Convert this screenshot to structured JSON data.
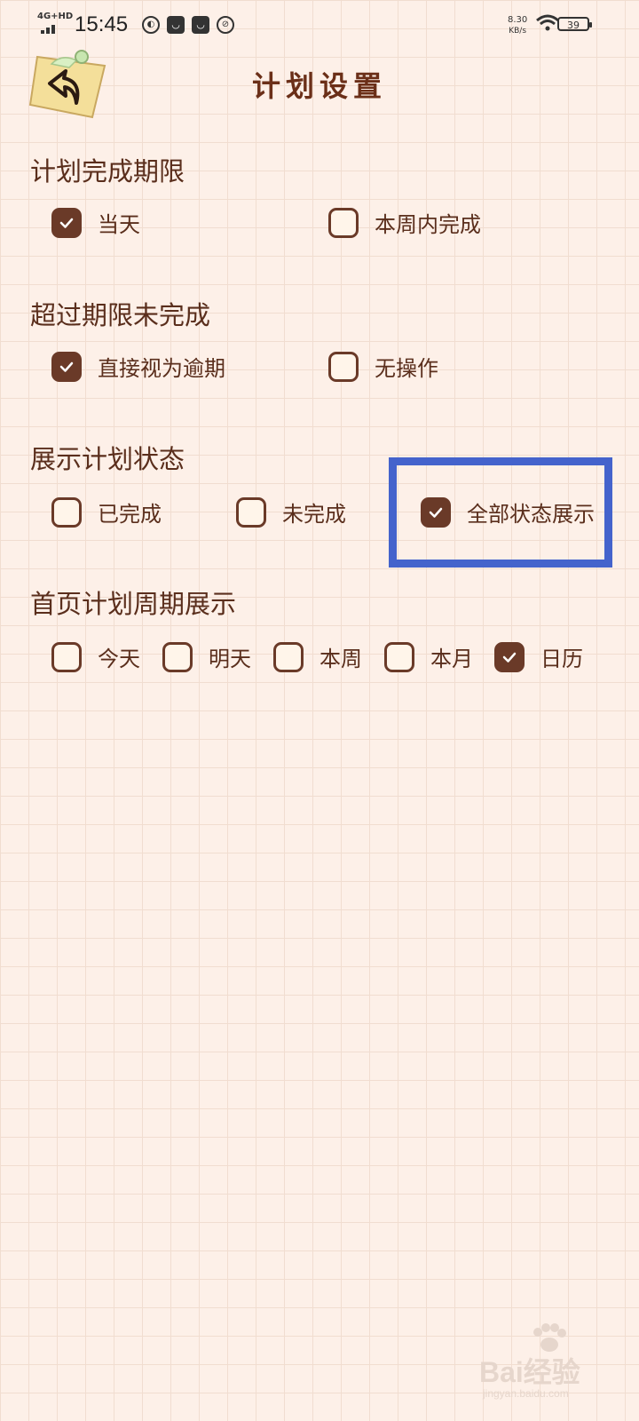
{
  "status_bar": {
    "network": "4G+HD",
    "time": "15:45",
    "notif_icons": [
      "usage-icon",
      "shopping-bag-icon",
      "shopping-bag-icon",
      "leaf-icon"
    ],
    "speed": "8.30",
    "speed_unit": "KB/s",
    "battery": "39"
  },
  "header": {
    "title": "计划设置",
    "back_icon": "back-arrow-icon"
  },
  "sections": [
    {
      "title": "计划完成期限",
      "options": [
        {
          "label": "当天",
          "checked": true
        },
        {
          "label": "本周内完成",
          "checked": false
        }
      ]
    },
    {
      "title": "超过期限未完成",
      "options": [
        {
          "label": "直接视为逾期",
          "checked": true
        },
        {
          "label": "无操作",
          "checked": false
        }
      ]
    },
    {
      "title": "展示计划状态",
      "options": [
        {
          "label": "已完成",
          "checked": false
        },
        {
          "label": "未完成",
          "checked": false
        },
        {
          "label": "全部状态展示",
          "checked": true
        }
      ]
    },
    {
      "title": "首页计划周期展示",
      "options": [
        {
          "label": "今天",
          "checked": false
        },
        {
          "label": "明天",
          "checked": false
        },
        {
          "label": "本周",
          "checked": false
        },
        {
          "label": "本月",
          "checked": false
        },
        {
          "label": "日历",
          "checked": true
        }
      ]
    }
  ],
  "colors": {
    "background": "#fdf0e8",
    "accent": "#6a3a28",
    "highlight": "#4463cc"
  },
  "watermark": {
    "main": "Bai经验",
    "sub": "jingyan.baidu.com"
  }
}
